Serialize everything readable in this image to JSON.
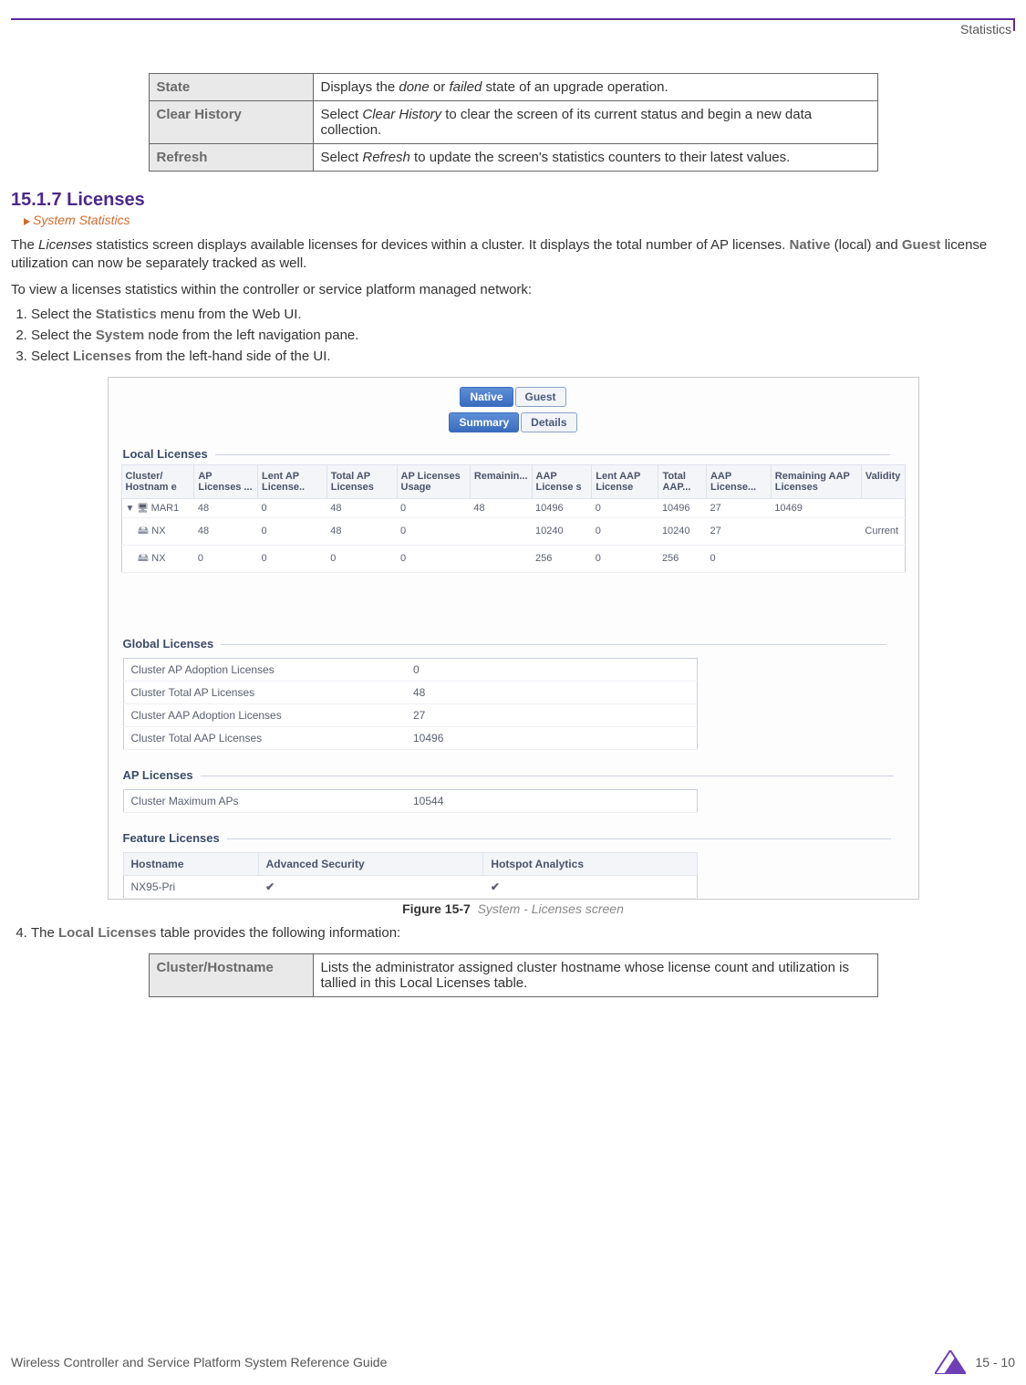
{
  "header": {
    "section_label": "Statistics"
  },
  "table_top": {
    "rows": [
      {
        "term": "State",
        "desc": "Displays the <span class=\"em\">done</span> or <span class=\"em\">failed</span> state of an upgrade operation."
      },
      {
        "term": "Clear History",
        "desc": "Select <span class=\"em\">Clear History</span> to clear the screen of its current status and begin a new data collection."
      },
      {
        "term": "Refresh",
        "desc": "Select <span class=\"em\">Refresh</span> to update the screen's statistics counters to their latest values."
      }
    ]
  },
  "section": {
    "number_title": "15.1.7 Licenses",
    "breadcrumb": "System Statistics",
    "para1_pre": "The ",
    "para1_em": "Licenses",
    "para1_mid": " statistics screen displays available licenses for devices within a cluster. It displays the total number of AP licenses. ",
    "para1_native": "Native",
    "para1_local": " (local) and ",
    "para1_guest": "Guest",
    "para1_end": " license utilization can now be separately tracked as well.",
    "para2": "To view a licenses statistics within the controller or service platform managed network:",
    "steps": [
      {
        "pre": "Select the ",
        "bold": "Statistics",
        "post": " menu from the Web UI."
      },
      {
        "pre": "Select the ",
        "bold": "System",
        "post": " node from the left navigation pane."
      },
      {
        "pre": "Select ",
        "bold": "Licenses",
        "post": " from the left-hand side of the UI."
      }
    ],
    "step4_pre": "The ",
    "step4_bold": "Local Licenses",
    "step4_post": " table provides the following information:"
  },
  "screenshot": {
    "tabs_top": [
      {
        "label": "Native",
        "active": true
      },
      {
        "label": "Guest",
        "active": false
      }
    ],
    "tabs_sub": [
      {
        "label": "Summary",
        "active": true
      },
      {
        "label": "Details",
        "active": false
      }
    ],
    "local_title": "Local Licenses",
    "local_headers": [
      "Cluster/ Hostnam e",
      "AP Licenses ...",
      "Lent AP License..",
      "Total AP Licenses",
      "AP Licenses Usage",
      "Remainin...",
      "AAP License s",
      "Lent AAP License",
      "Total AAP...",
      "AAP License...",
      "Remaining AAP Licenses",
      "Validity"
    ],
    "local_rows": [
      {
        "icon": "tree",
        "name": "MAR1",
        "cells": [
          "48",
          "0",
          "48",
          "0",
          "48",
          "10496",
          "0",
          "10496",
          "27",
          "10469",
          ""
        ]
      },
      {
        "icon": "server",
        "name": "NX",
        "cells": [
          "48",
          "0",
          "48",
          "0",
          "",
          "10240",
          "0",
          "10240",
          "27",
          "",
          "Current"
        ]
      },
      {
        "icon": "server",
        "name": "NX",
        "cells": [
          "0",
          "0",
          "0",
          "0",
          "",
          "256",
          "0",
          "256",
          "0",
          "",
          ""
        ]
      }
    ],
    "global_title": "Global Licenses",
    "global_rows": [
      {
        "k": "Cluster AP Adoption Licenses",
        "v": "0"
      },
      {
        "k": "Cluster Total AP Licenses",
        "v": "48"
      },
      {
        "k": "Cluster AAP Adoption Licenses",
        "v": "27"
      },
      {
        "k": "Cluster Total AAP Licenses",
        "v": "10496"
      }
    ],
    "ap_title": "AP Licenses",
    "ap_rows": [
      {
        "k": "Cluster Maximum APs",
        "v": "10544"
      }
    ],
    "feature_title": "Feature Licenses",
    "feature_headers": [
      "Hostname",
      "Advanced Security",
      "Hotspot Analytics"
    ],
    "feature_row": {
      "host": "NX95-Pri",
      "adv": "✔",
      "hot": "✔"
    },
    "caption_num": "Figure 15-7",
    "caption_text": "System - Licenses screen"
  },
  "table_bottom": {
    "rows": [
      {
        "term": "Cluster/Hostname",
        "desc": "Lists the administrator assigned cluster hostname whose license count and utilization is tallied in this Local Licenses table."
      }
    ]
  },
  "footer": {
    "left": "Wireless Controller and Service Platform System Reference Guide",
    "page": "15 - 10"
  }
}
